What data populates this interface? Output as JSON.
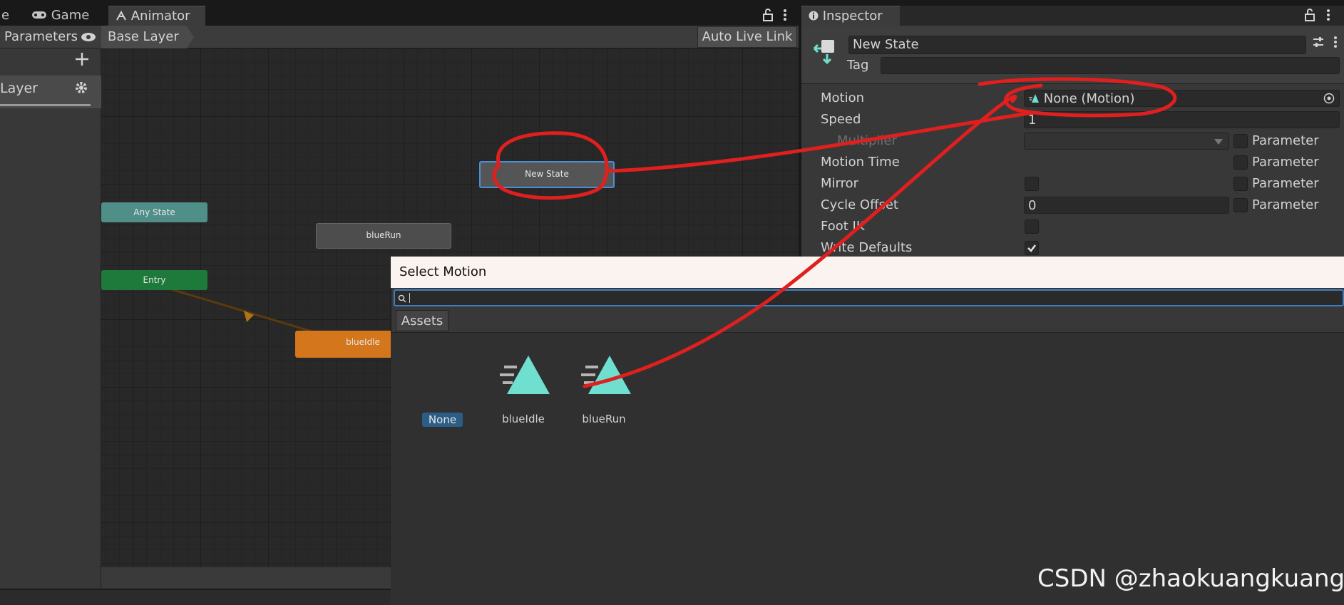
{
  "tabs": {
    "scene_partial": "e",
    "game": "Game",
    "animator": "Animator",
    "inspector": "Inspector"
  },
  "animator": {
    "parameters_label": "Parameters",
    "breadcrumb": "Base Layer",
    "auto_live_link": "Auto Live Link",
    "layer_name": "Layer",
    "nodes": {
      "new_state": "New State",
      "any_state": "Any State",
      "blue_run": "blueRun",
      "entry": "Entry",
      "blue_idle": "blueIdle"
    },
    "colors": {
      "any_state": "#4f8f88",
      "entry": "#1d7a3a",
      "blue_idle": "#d4761c",
      "default": "#555555",
      "selected_outline": "#4a90d9"
    }
  },
  "inspector": {
    "state_name": "New State",
    "tag_label": "Tag",
    "tag_value": "",
    "rows": {
      "motion_label": "Motion",
      "motion_value": "None (Motion)",
      "speed_label": "Speed",
      "speed_value": "1",
      "multiplier_label": "Multiplier",
      "motion_time_label": "Motion Time",
      "mirror_label": "Mirror",
      "cycle_offset_label": "Cycle Offset",
      "cycle_offset_value": "0",
      "foot_ik_label": "Foot IK",
      "write_defaults_label": "Write Defaults",
      "parameter_label": "Parameter"
    },
    "write_defaults_checked": true
  },
  "dialog": {
    "title": "Select Motion",
    "search_value": "",
    "tab": "Assets",
    "items": [
      {
        "label": "None",
        "icon": "none",
        "selected": true
      },
      {
        "label": "blueIdle",
        "icon": "animation-clip-icon",
        "selected": false
      },
      {
        "label": "blueRun",
        "icon": "animation-clip-icon",
        "selected": false
      }
    ]
  },
  "watermark": "CSDN @zhaokuangkuang_"
}
